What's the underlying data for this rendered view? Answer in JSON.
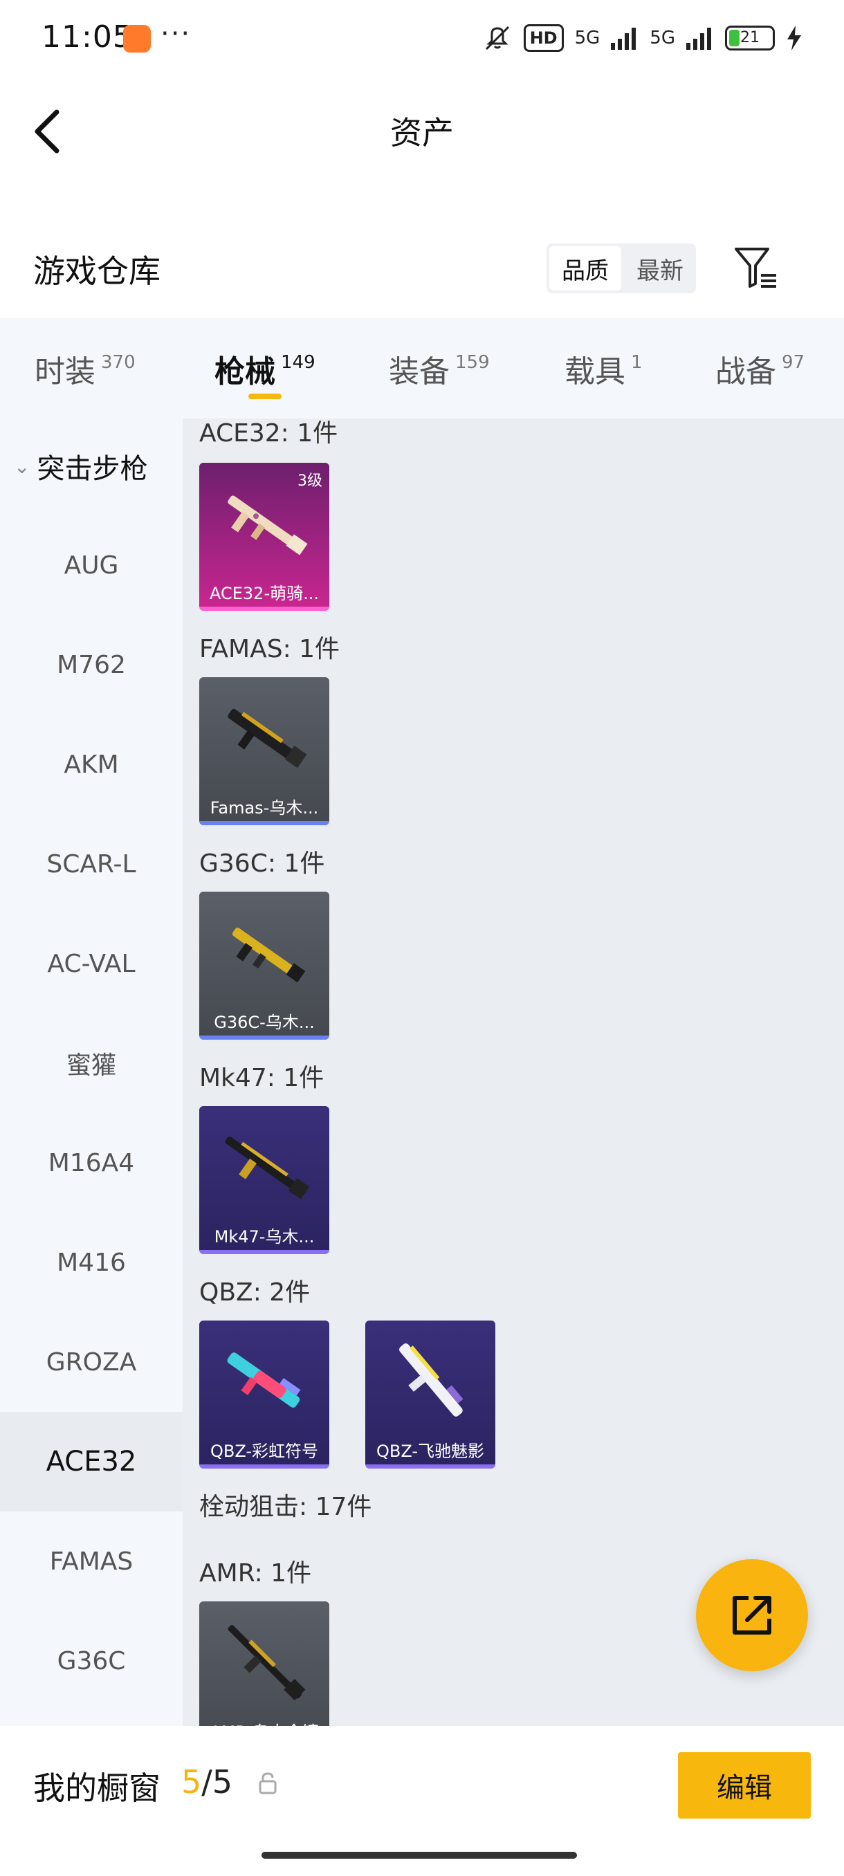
{
  "status_bar": {
    "time": "11:05",
    "more": "···",
    "hd_label": "HD",
    "net1": "5G",
    "net2": "5G",
    "battery": "21",
    "icons": [
      "notification-app-icon",
      "mute-icon",
      "signal-icon",
      "battery-icon",
      "charging-icon"
    ]
  },
  "header": {
    "title": "资产",
    "back_icon": "back-arrow-icon"
  },
  "warehouse": {
    "title": "游戏仓库",
    "sort_options": [
      "品质",
      "最新"
    ],
    "sort_selected": "品质",
    "filter_icon": "filter-icon"
  },
  "tabs": [
    {
      "label": "时装",
      "count": "370"
    },
    {
      "label": "枪械",
      "count": "149",
      "active": true
    },
    {
      "label": "装备",
      "count": "159"
    },
    {
      "label": "载具",
      "count": "1"
    },
    {
      "label": "战备",
      "count": "97"
    }
  ],
  "sidebar": {
    "section": "突击步枪",
    "items": [
      "AUG",
      "M762",
      "AKM",
      "SCAR-L",
      "AC-VAL",
      "蜜獾",
      "M16A4",
      "M416",
      "GROZA",
      "ACE32",
      "FAMAS",
      "G36C"
    ],
    "active": "ACE32"
  },
  "groups": {
    "ace32": {
      "label": "ACE32: 1件",
      "items": [
        {
          "name": "ACE32-萌骑...",
          "level": "3级"
        }
      ]
    },
    "famas": {
      "label": "FAMAS: 1件",
      "items": [
        {
          "name": "Famas-乌木..."
        }
      ]
    },
    "g36c": {
      "label": "G36C: 1件",
      "items": [
        {
          "name": "G36C-乌木..."
        }
      ]
    },
    "mk47": {
      "label": "Mk47: 1件",
      "items": [
        {
          "name": "Mk47-乌木..."
        }
      ]
    },
    "qbz": {
      "label": "QBZ: 2件",
      "items": [
        {
          "name": "QBZ-彩虹符号"
        },
        {
          "name": "QBZ-飞驰魅影"
        }
      ]
    },
    "bolt_category": {
      "label": "栓动狙击: 17件"
    },
    "amr": {
      "label": "AMR: 1件",
      "items": [
        {
          "name": "AMR-乌木金镶"
        }
      ]
    }
  },
  "fab": {
    "icon": "share-external-icon"
  },
  "bottom": {
    "label": "我的橱窗",
    "current": "5",
    "slash": "/",
    "max": "5",
    "lock_icon": "lock-icon",
    "edit_label": "编辑"
  },
  "colors": {
    "accent": "#f8b70c",
    "tab_bg": "#f4f7fb",
    "content_bg": "#eaedf1",
    "card_gray": "#4f535a",
    "card_purple": "#2f2868",
    "card_pink": "#b0237f"
  }
}
